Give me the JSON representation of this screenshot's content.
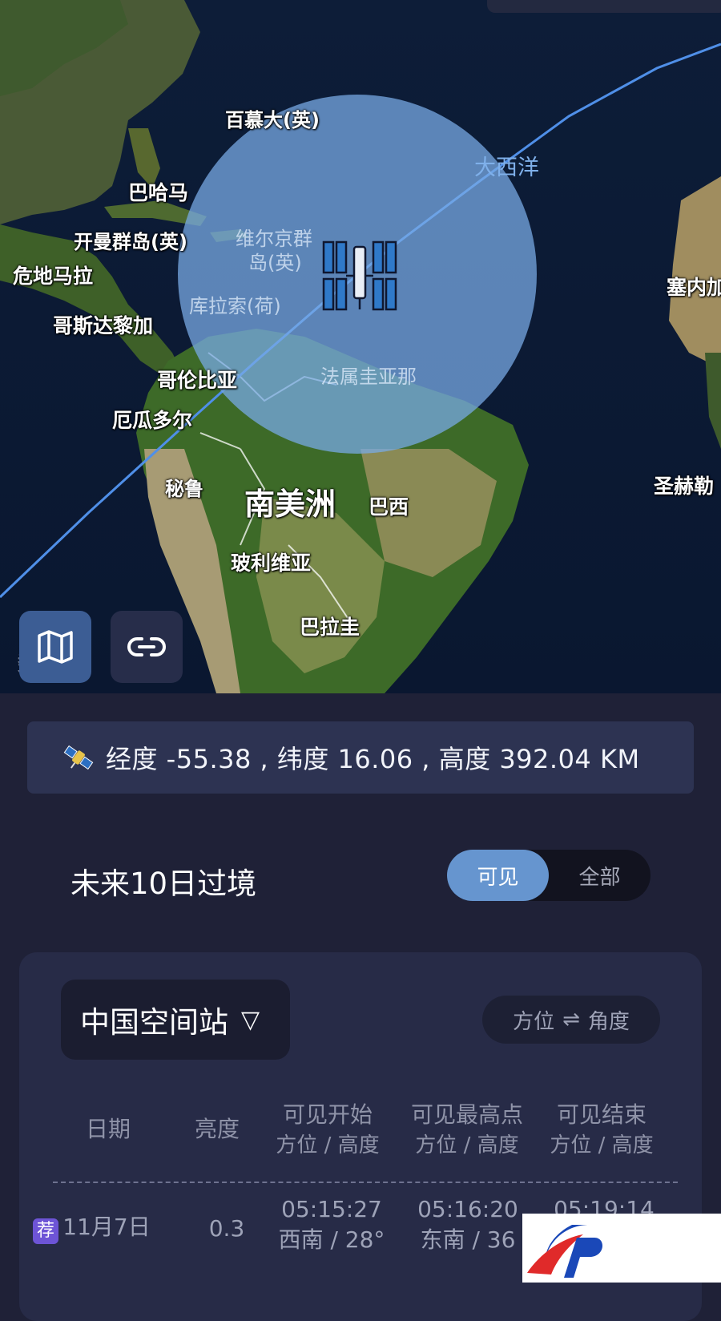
{
  "map": {
    "place_labels": {
      "bermuda": "百慕大(英)",
      "atlantic": "大西洋",
      "bahamas": "巴哈马",
      "cayman": "开曼群岛(英)",
      "virgin_islands_1": "维尔京群",
      "virgin_islands_2": "岛(英)",
      "guatemala": "危地马拉",
      "curacao": "库拉索(荷)",
      "costa_rica": "哥斯达黎加",
      "colombia": "哥伦比亚",
      "french_guiana": "法属圭亚那",
      "ecuador": "厄瓜多尔",
      "senegal": "塞内加",
      "peru": "秘鲁",
      "south_america": "南美洲",
      "brazil": "巴西",
      "saint_helena": "圣赫勒",
      "bolivia": "玻利维亚",
      "paraguay": "巴拉圭"
    },
    "watermark_text": "数"
  },
  "controls": {
    "map_layer_icon": "map-icon",
    "link_icon": "link-icon"
  },
  "position": {
    "text": "经度 -55.38 , 纬度 16.06 , 高度 392.04 KM",
    "icon": "satellite-icon"
  },
  "passes": {
    "title": "未来10日过境",
    "filter_options": [
      "可见",
      "全部"
    ],
    "filter_selected": "可见",
    "satellite_name": "中国空间站",
    "satellite_caret": "▽",
    "mode_left": "方位",
    "mode_arrows": "⇌",
    "mode_right": "角度",
    "columns": [
      {
        "title": "日期",
        "sub": ""
      },
      {
        "title": "亮度",
        "sub": ""
      },
      {
        "title": "可见开始",
        "sub": "方位 / 高度"
      },
      {
        "title": "可见最高点",
        "sub": "方位 / 高度"
      },
      {
        "title": "可见结束",
        "sub": "方位 / 高度"
      }
    ],
    "rows": [
      {
        "badge": "荐",
        "date": "11月7日",
        "brightness": "0.3",
        "start_time": "05:15:27",
        "start_pos": "西南 / 28°",
        "peak_time": "05:16:20",
        "peak_pos": "东南 / 36",
        "end_time": "05:19:14",
        "end_pos": ""
      }
    ]
  },
  "colors": {
    "accent": "#6695cf",
    "background": "#1f2137",
    "card": "#272b47",
    "badge": "#6d54d6",
    "footprint": "#78aae6",
    "orbit": "#4f8fe8"
  }
}
